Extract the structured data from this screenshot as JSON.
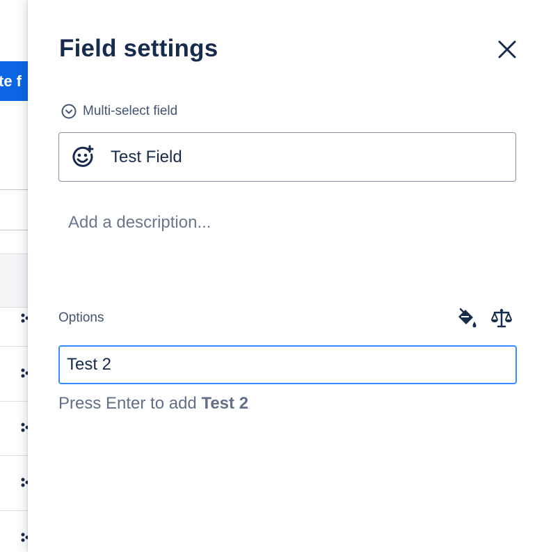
{
  "background": {
    "button_label": "te f"
  },
  "panel": {
    "title": "Field settings",
    "field_type": "Multi-select field",
    "field_name": "Test Field",
    "description_placeholder": "Add a description...",
    "options_label": "Options",
    "option_input_value": "Test 2",
    "hint_prefix": "Press Enter to add ",
    "hint_value": "Test 2"
  },
  "icons": {
    "close": "close-icon",
    "field_type": "chevron-down-circle-icon",
    "emoji": "emoji-add-icon",
    "color": "paint-bucket-icon",
    "sort": "balance-scale-icon"
  },
  "colors": {
    "accent": "#0c66e4",
    "focus_border": "#388bff",
    "text": "#172b4d",
    "subtle_text": "#626f86"
  }
}
